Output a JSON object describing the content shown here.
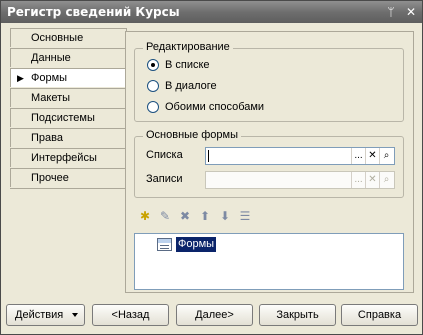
{
  "window": {
    "title": "Регистр сведений Курсы"
  },
  "titlebar_buttons": {
    "pin": "ᛘ",
    "close": "✕"
  },
  "sidebar": {
    "items": [
      {
        "label": "Основные",
        "active": false
      },
      {
        "label": "Данные",
        "active": false
      },
      {
        "label": "Формы",
        "active": true
      },
      {
        "label": "Макеты",
        "active": false
      },
      {
        "label": "Подсистемы",
        "active": false
      },
      {
        "label": "Права",
        "active": false
      },
      {
        "label": "Интерфейсы",
        "active": false
      },
      {
        "label": "Прочее",
        "active": false
      }
    ]
  },
  "editing": {
    "title": "Редактирование",
    "options": [
      {
        "label": "В списке",
        "selected": true
      },
      {
        "label": "В диалоге",
        "selected": false
      },
      {
        "label": "Обоими способами",
        "selected": false
      }
    ]
  },
  "main_forms": {
    "title": "Основные формы",
    "list_label": "Списка",
    "list_value": "",
    "record_label": "Записи",
    "record_value": ""
  },
  "field_buttons": {
    "select": "...",
    "clear": "✕",
    "open": "⌕"
  },
  "tree": {
    "root_label": "Формы"
  },
  "footer": {
    "actions": "Действия",
    "back": "<Назад",
    "next": "Далее>",
    "close": "Закрыть",
    "help": "Справка"
  },
  "colors": {
    "titlebar": "#6e6e6e",
    "panel_bg": "#ece9d8",
    "selection": "#0a246a"
  }
}
